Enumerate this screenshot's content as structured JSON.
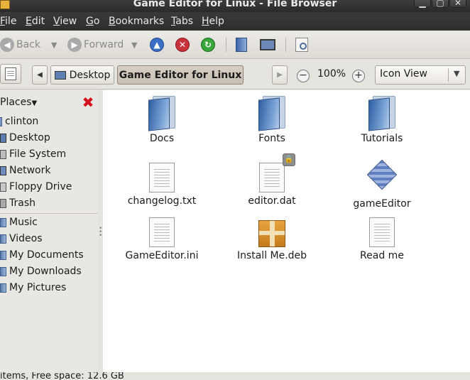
{
  "window": {
    "title": "Game Editor for Linux - File Browser"
  },
  "menubar": {
    "items": [
      "File",
      "Edit",
      "View",
      "Go",
      "Bookmarks",
      "Tabs",
      "Help"
    ],
    "mnemonics": [
      "F",
      "E",
      "V",
      "G",
      "B",
      "T",
      "H"
    ]
  },
  "toolbar": {
    "back_label": "Back",
    "forward_label": "Forward"
  },
  "location": {
    "crumbs": [
      "Desktop",
      "Game Editor for Linux"
    ],
    "zoom": "100%",
    "view_mode": "Icon View"
  },
  "sidebar": {
    "header": "Places",
    "places": [
      "clinton",
      "Desktop",
      "File System",
      "Network",
      "Floppy Drive",
      "Trash"
    ],
    "bookmarks": [
      "Music",
      "Videos",
      "My Documents",
      "My Downloads",
      "My Pictures"
    ]
  },
  "files": [
    {
      "name": "Docs",
      "kind": "folder"
    },
    {
      "name": "Fonts",
      "kind": "folder"
    },
    {
      "name": "Tutorials",
      "kind": "folder"
    },
    {
      "name": "changelog.txt",
      "kind": "text"
    },
    {
      "name": "editor.dat",
      "kind": "locked-file"
    },
    {
      "name": "gameEditor",
      "kind": "executable"
    },
    {
      "name": "GameEditor.ini",
      "kind": "text"
    },
    {
      "name": "Install Me.deb",
      "kind": "package"
    },
    {
      "name": "Read me",
      "kind": "text"
    }
  ],
  "status": {
    "text": "items, Free space: 12.6 GB"
  },
  "colors": {
    "titlebar": "#2e2e2e",
    "menubar": "#333333",
    "remove_bookmark": "#d0101a",
    "breadcrumb_active": "#d6cfc5"
  }
}
